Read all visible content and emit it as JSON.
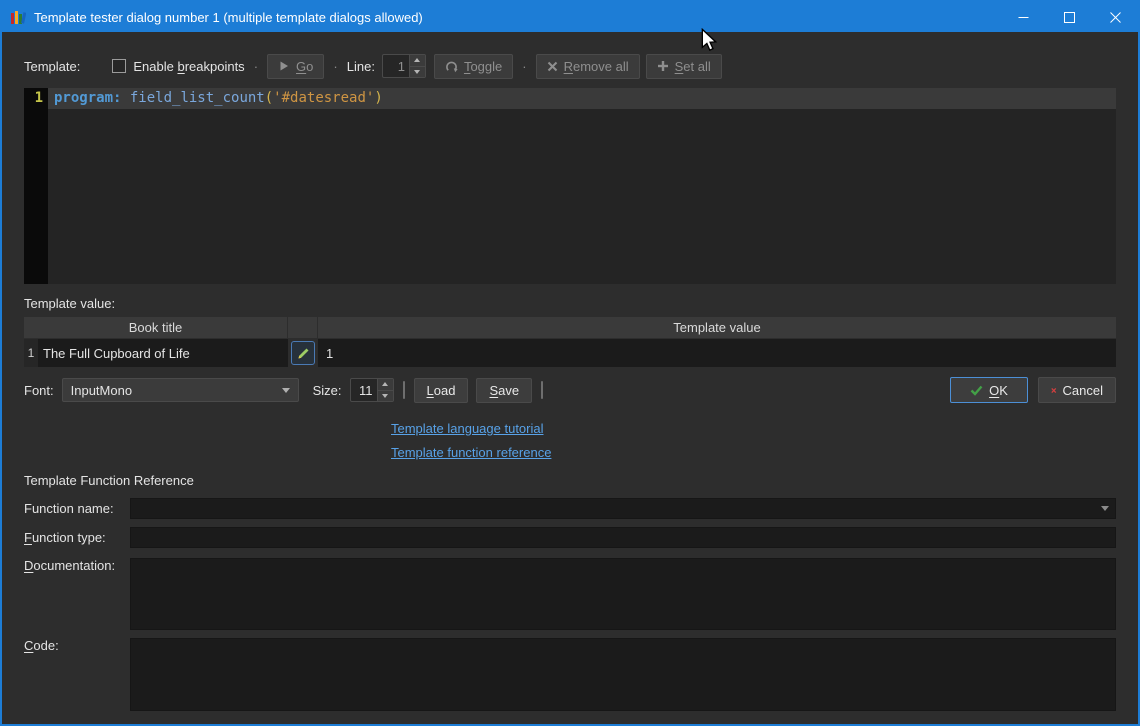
{
  "window": {
    "title": "Template tester dialog number 1 (multiple template dialogs allowed)"
  },
  "toolbar": {
    "template_label": "Template:",
    "enable_breakpoints": "Enable &breakpoints",
    "go": "&Go",
    "line_label": "Line:",
    "line_value": "1",
    "toggle": "&Toggle",
    "remove_all": "&Remove all",
    "set_all": "&Set all"
  },
  "editor": {
    "line_number": "1",
    "code": {
      "keyword": "program:",
      "function": " field_list_count",
      "open_paren": "(",
      "string": "'#datesread'",
      "close_paren": ")"
    }
  },
  "template_value": {
    "label": "Template value:",
    "headers": {
      "book_title": "Book title",
      "template_value": "Template value"
    },
    "rows": [
      {
        "index": "1",
        "title": "The Full Cupboard of Life",
        "value": "1"
      }
    ]
  },
  "font_bar": {
    "font_label": "Font:",
    "font_value": "InputMono",
    "size_label": "Size:",
    "size_value": "11",
    "load": "&Load",
    "save": "&Save",
    "ok": "&OK",
    "cancel": "Cancel"
  },
  "links": {
    "tutorial": "Template language tutorial",
    "reference": "Template function reference"
  },
  "function_reference": {
    "title": "Template Function Reference",
    "name_label": "Function name:",
    "type_label": "&Function type:",
    "documentation_label": "&Documentation:",
    "code_label": "&Code:"
  },
  "colors": {
    "titlebar_blue": "#1d7dd6",
    "link_blue": "#58a2e8",
    "code_keyword_blue": "#529ad6",
    "code_string_orange": "#cf9543",
    "ok_border_blue": "#4c8fd6",
    "check_green": "#43a047",
    "cancel_red": "#d23f3f"
  }
}
